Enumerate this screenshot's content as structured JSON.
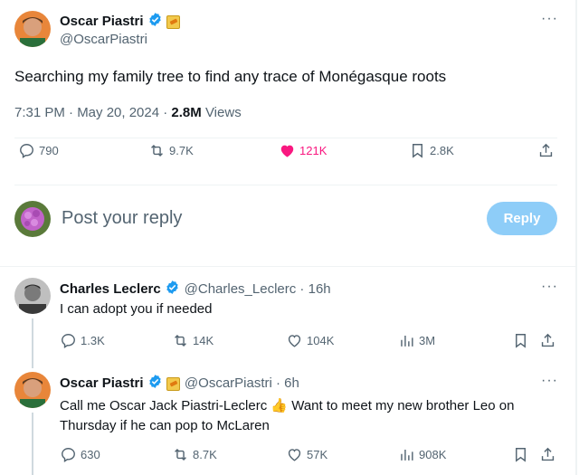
{
  "main_tweet": {
    "author_name": "Oscar Piastri",
    "author_handle": "@OscarPiastri",
    "text": "Searching my family tree to find any trace of Monégasque roots",
    "timestamp": "7:31 PM · May 20, 2024 · ",
    "views_count": "2.8M",
    "views_label": " Views",
    "stats": {
      "replies": "790",
      "reposts": "9.7K",
      "likes": "121K",
      "bookmarks": "2.8K"
    },
    "like_color": "#f91880"
  },
  "composer": {
    "placeholder": "Post your reply",
    "reply_button": "Reply"
  },
  "replies": [
    {
      "author_name": "Charles Leclerc",
      "author_handle": "@Charles_Leclerc",
      "time": " · 16h",
      "text": "I can adopt you if needed",
      "stats": {
        "replies": "1.3K",
        "reposts": "14K",
        "likes": "104K",
        "views": "3M"
      }
    },
    {
      "author_name": "Oscar Piastri",
      "author_handle": "@OscarPiastri",
      "time": " · 6h",
      "text_line1": "Call me Oscar Jack Piastri-Leclerc 👍 Want to meet my new brother Leo on",
      "text_line2": "Thursday if he can pop to McLaren",
      "stats": {
        "replies": "630",
        "reposts": "8.7K",
        "likes": "57K",
        "views": "908K"
      }
    }
  ],
  "colors": {
    "accent": "#1d9bf0",
    "reply_button_disabled": "#8ecdf8",
    "text_secondary": "#536471"
  }
}
